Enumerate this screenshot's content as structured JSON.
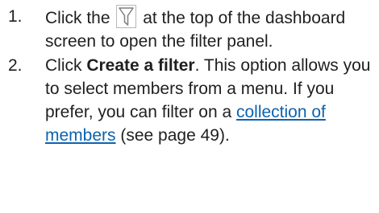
{
  "steps": [
    {
      "number": "1.",
      "text_before_icon": "Click the",
      "icon": "filter-funnel-icon",
      "text_after_icon": " at the top of the dashboard screen to open the filter panel."
    },
    {
      "number": "2.",
      "text_before_bold": "Click ",
      "bold_text": "Create a filter",
      "text_after_bold": ". This option allows you to select members from a menu. If you prefer, you can filter on a ",
      "link_text": "collection of members",
      "text_after_link": " (see page 49)."
    }
  ],
  "colors": {
    "text": "#1f1f1f",
    "link": "#0b63b0",
    "icon_border": "#b7b7b7",
    "icon_stroke": "#7f7f7f"
  }
}
